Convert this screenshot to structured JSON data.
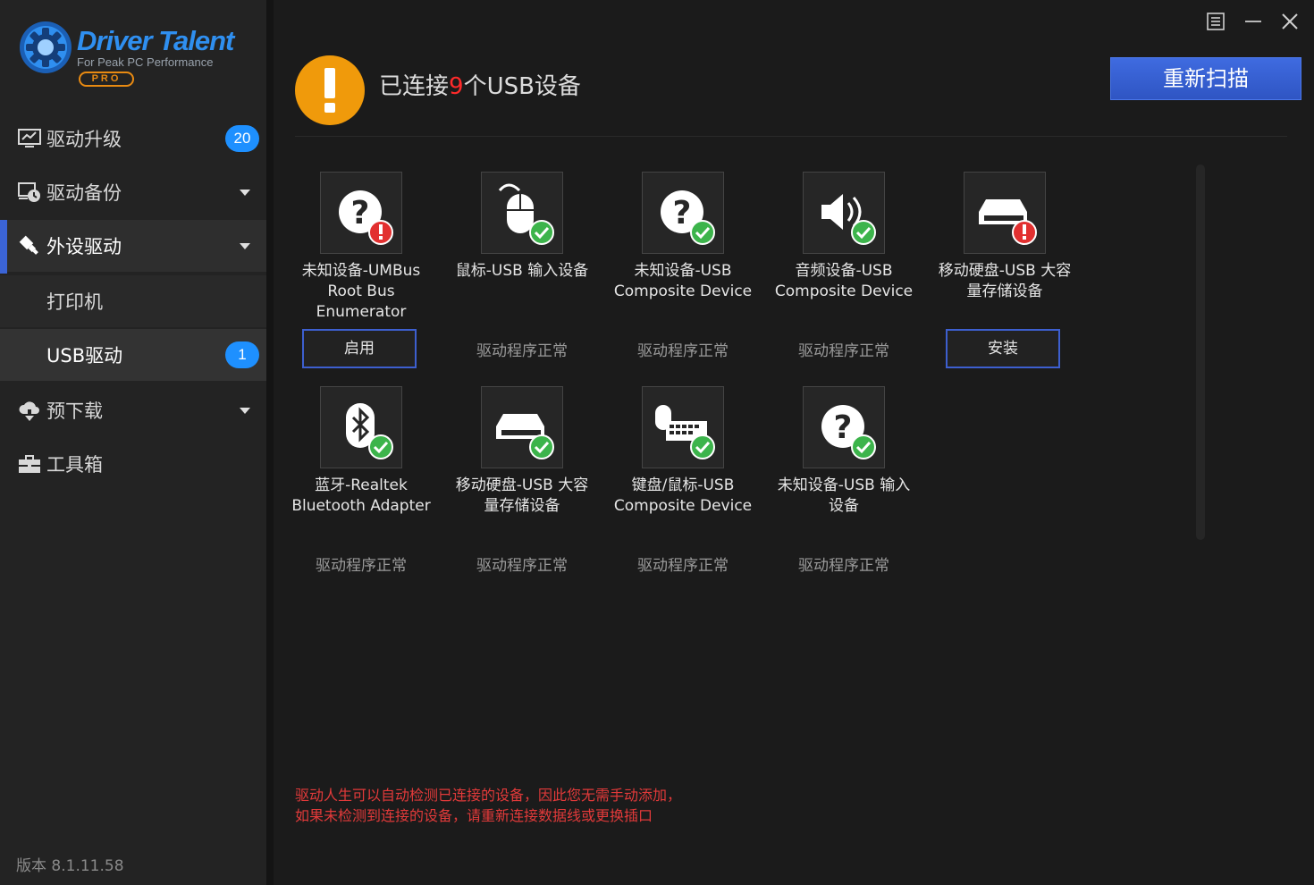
{
  "app": {
    "logo_title": "Driver Talent",
    "logo_subtitle": "For Peak PC Performance",
    "logo_edition": "PRO",
    "version": "版本 8.1.11.58",
    "brand_color": "#2f8ff0",
    "accent_color": "#3b64d6"
  },
  "sidebar": {
    "items": [
      {
        "label": "驱动升级",
        "icon": "monitor-icon",
        "badge": "20"
      },
      {
        "label": "驱动备份",
        "icon": "backup-clock-icon"
      },
      {
        "label": "外设驱动",
        "icon": "usb-plug-icon"
      },
      {
        "label": "打印机"
      },
      {
        "label": "USB驱动",
        "badge": "1"
      },
      {
        "label": "预下载",
        "icon": "cloud-download-icon"
      },
      {
        "label": "工具箱",
        "icon": "toolbox-icon"
      }
    ]
  },
  "window": {
    "controls": [
      "menu-icon",
      "minimize-icon",
      "close-icon"
    ]
  },
  "header": {
    "title_prefix": "已连接",
    "title_count": "9",
    "title_suffix": "个USB设备",
    "rescan_label": "重新扫描",
    "alert_color": "#f09a0b"
  },
  "devices": [
    {
      "name_line1": "未知设备-UMBus",
      "name_line2": "Root Bus",
      "name_line3": "Enumerator",
      "icon": "unknown-device-icon",
      "badge": "error",
      "action": "启用"
    },
    {
      "name_line1": "鼠标-USB 输入设备",
      "name_line2": "",
      "name_line3": "",
      "icon": "mouse-icon",
      "badge": "ok",
      "status": "驱动程序正常"
    },
    {
      "name_line1": "未知设备-USB",
      "name_line2": "Composite Device",
      "name_line3": "",
      "icon": "unknown-device-icon",
      "badge": "ok",
      "status": "驱动程序正常"
    },
    {
      "name_line1": "音频设备-USB",
      "name_line2": "Composite Device",
      "name_line3": "",
      "icon": "speaker-icon",
      "badge": "ok",
      "status": "驱动程序正常"
    },
    {
      "name_line1": "移动硬盘-USB 大容",
      "name_line2": "量存储设备",
      "name_line3": "",
      "icon": "hard-drive-icon",
      "badge": "error",
      "action": "安装"
    },
    {
      "name_line1": "蓝牙-Realtek",
      "name_line2": "Bluetooth Adapter",
      "name_line3": "",
      "icon": "bluetooth-icon",
      "badge": "ok",
      "status": "驱动程序正常"
    },
    {
      "name_line1": "移动硬盘-USB 大容",
      "name_line2": "量存储设备",
      "name_line3": "",
      "icon": "hard-drive-icon",
      "badge": "ok",
      "status": "驱动程序正常"
    },
    {
      "name_line1": "键盘/鼠标-USB",
      "name_line2": "Composite Device",
      "name_line3": "",
      "icon": "keyboard-mouse-icon",
      "badge": "ok",
      "status": "驱动程序正常"
    },
    {
      "name_line1": "未知设备-USB 输入",
      "name_line2": "设备",
      "name_line3": "",
      "icon": "unknown-device-icon",
      "badge": "ok",
      "status": "驱动程序正常"
    }
  ],
  "footer": {
    "note_line1": "驱动人生可以自动检测已连接的设备，因此您无需手动添加，",
    "note_line2": "如果未检测到连接的设备，请重新连接数据线或更换插口"
  }
}
